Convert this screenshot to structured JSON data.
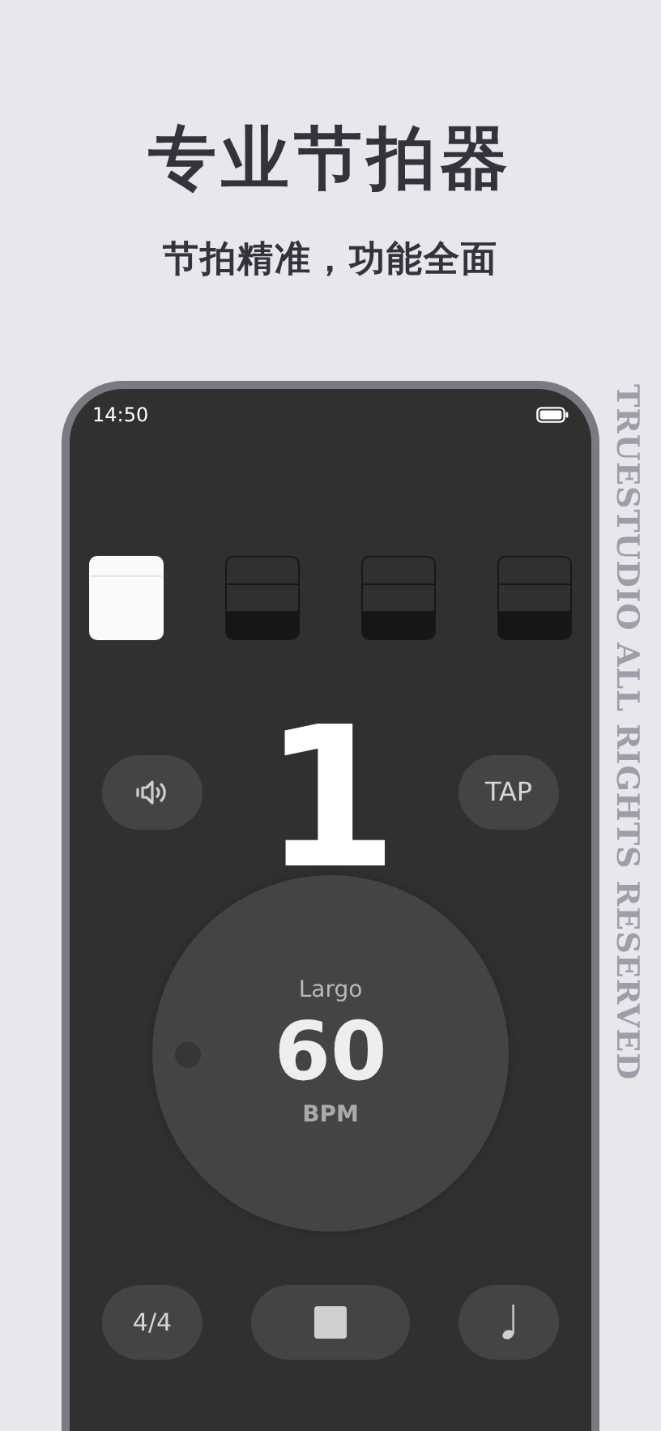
{
  "header": {
    "title": "专业节拍器",
    "subtitle": "节拍精准，功能全面"
  },
  "status_bar": {
    "time": "14:50"
  },
  "beats": [
    {
      "active": true
    },
    {
      "active": false
    },
    {
      "active": false
    },
    {
      "active": false
    }
  ],
  "beat_number": "1",
  "tap_button": {
    "label": "TAP"
  },
  "tempo": {
    "marking": "Largo",
    "bpm": "60",
    "unit": "BPM"
  },
  "time_signature": "4/4",
  "playing": true,
  "side_text": "TRUESTUDIO ALL RIGHTS RESERVED"
}
